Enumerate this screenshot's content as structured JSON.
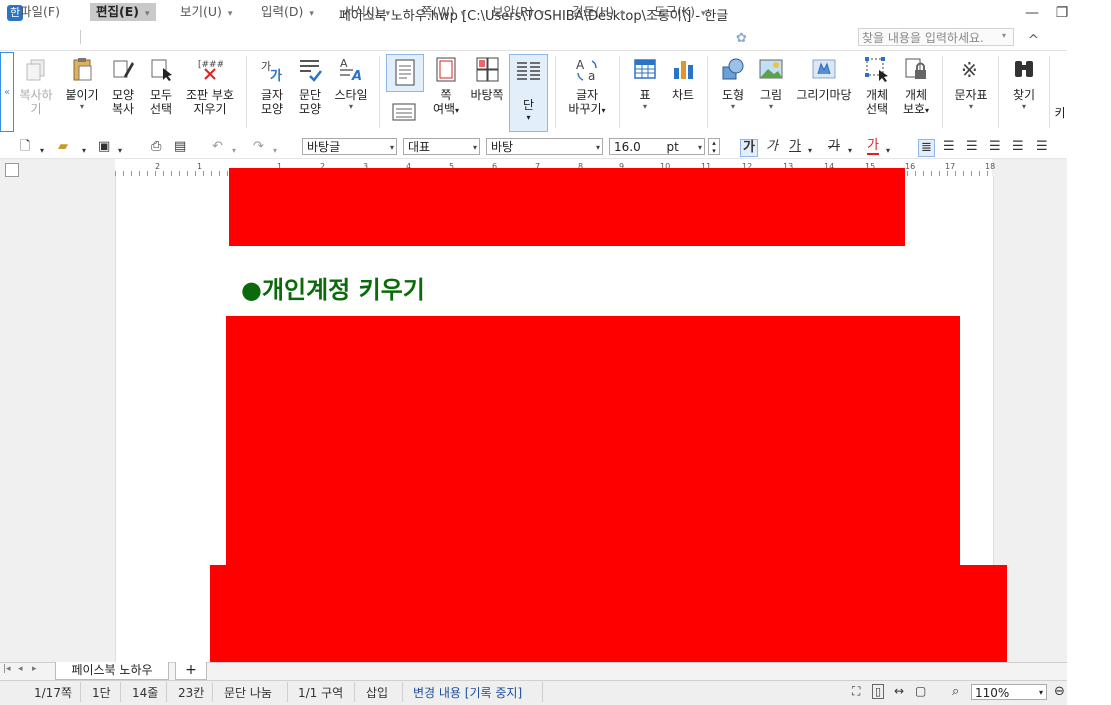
{
  "window": {
    "title": "페이스북 노하우.hwp [C:\\Users\\TOSHIBA\\Desktop\\조롱이\\] - 한글",
    "app_icon_glyph": "한",
    "minimize": "—",
    "restore": "❐",
    "collapse_ribbon": "^"
  },
  "menu": {
    "items": [
      "파일(F)",
      "편집(E)",
      "보기(U)",
      "입력(D)",
      "서식(J)",
      "쪽(W)",
      "보안(R)",
      "검토(H)",
      "도구(K)"
    ],
    "search_placeholder": "찾을 내용을 입력하세요."
  },
  "ribbon": {
    "copy": "복사하기",
    "paste": "붙이기",
    "format_copy": [
      "모양",
      "복사"
    ],
    "select_all": [
      "모두",
      "선택"
    ],
    "clear_marks": [
      "조판 부호",
      "지우기"
    ],
    "char_shape": [
      "글자",
      "모양"
    ],
    "para_shape": [
      "문단",
      "모양"
    ],
    "style": "스타일",
    "margin": [
      "쪽",
      "여백"
    ],
    "page_bg": "바탕쪽",
    "columns": "단",
    "change_case": [
      "글자",
      "바꾸기"
    ],
    "table": "표",
    "chart": "차트",
    "shape": "도형",
    "picture": "그림",
    "gallery": "그리기마당",
    "select_obj": [
      "개체",
      "선택"
    ],
    "protect_obj": [
      "개체",
      "보호"
    ],
    "symbol": "문자표",
    "find": "찾기",
    "more": "키"
  },
  "format_toolbar": {
    "style_combo": "바탕글",
    "font_lang": "대표",
    "font_name": "바탕",
    "font_size": "16.0",
    "font_unit": "pt",
    "bold": "가",
    "italic": "가",
    "underline": "가",
    "strike": "가",
    "color": "가"
  },
  "ruler": {
    "numbers": [
      "2",
      "1",
      "1",
      "2",
      "3",
      "4",
      "5",
      "6",
      "7",
      "8",
      "9",
      "10",
      "11",
      "12",
      "13",
      "14",
      "15",
      "16",
      "17",
      "18"
    ]
  },
  "document": {
    "heading": "●개인계정 키우기"
  },
  "tabs": {
    "doc_tab": "페이스북 노하우",
    "add": "+"
  },
  "status": {
    "page": "1/17쪽",
    "column": "1단",
    "line": "14줄",
    "col": "23칸",
    "break": "문단 나눔",
    "section": "1/1 구역",
    "mode": "삽입",
    "track": "변경 내용 [기록 중지]",
    "zoom": "110%"
  },
  "colors": {
    "heading_green": "#0b6b0b",
    "redaction": "#ff0000",
    "accent_blue": "#2b73c7"
  }
}
